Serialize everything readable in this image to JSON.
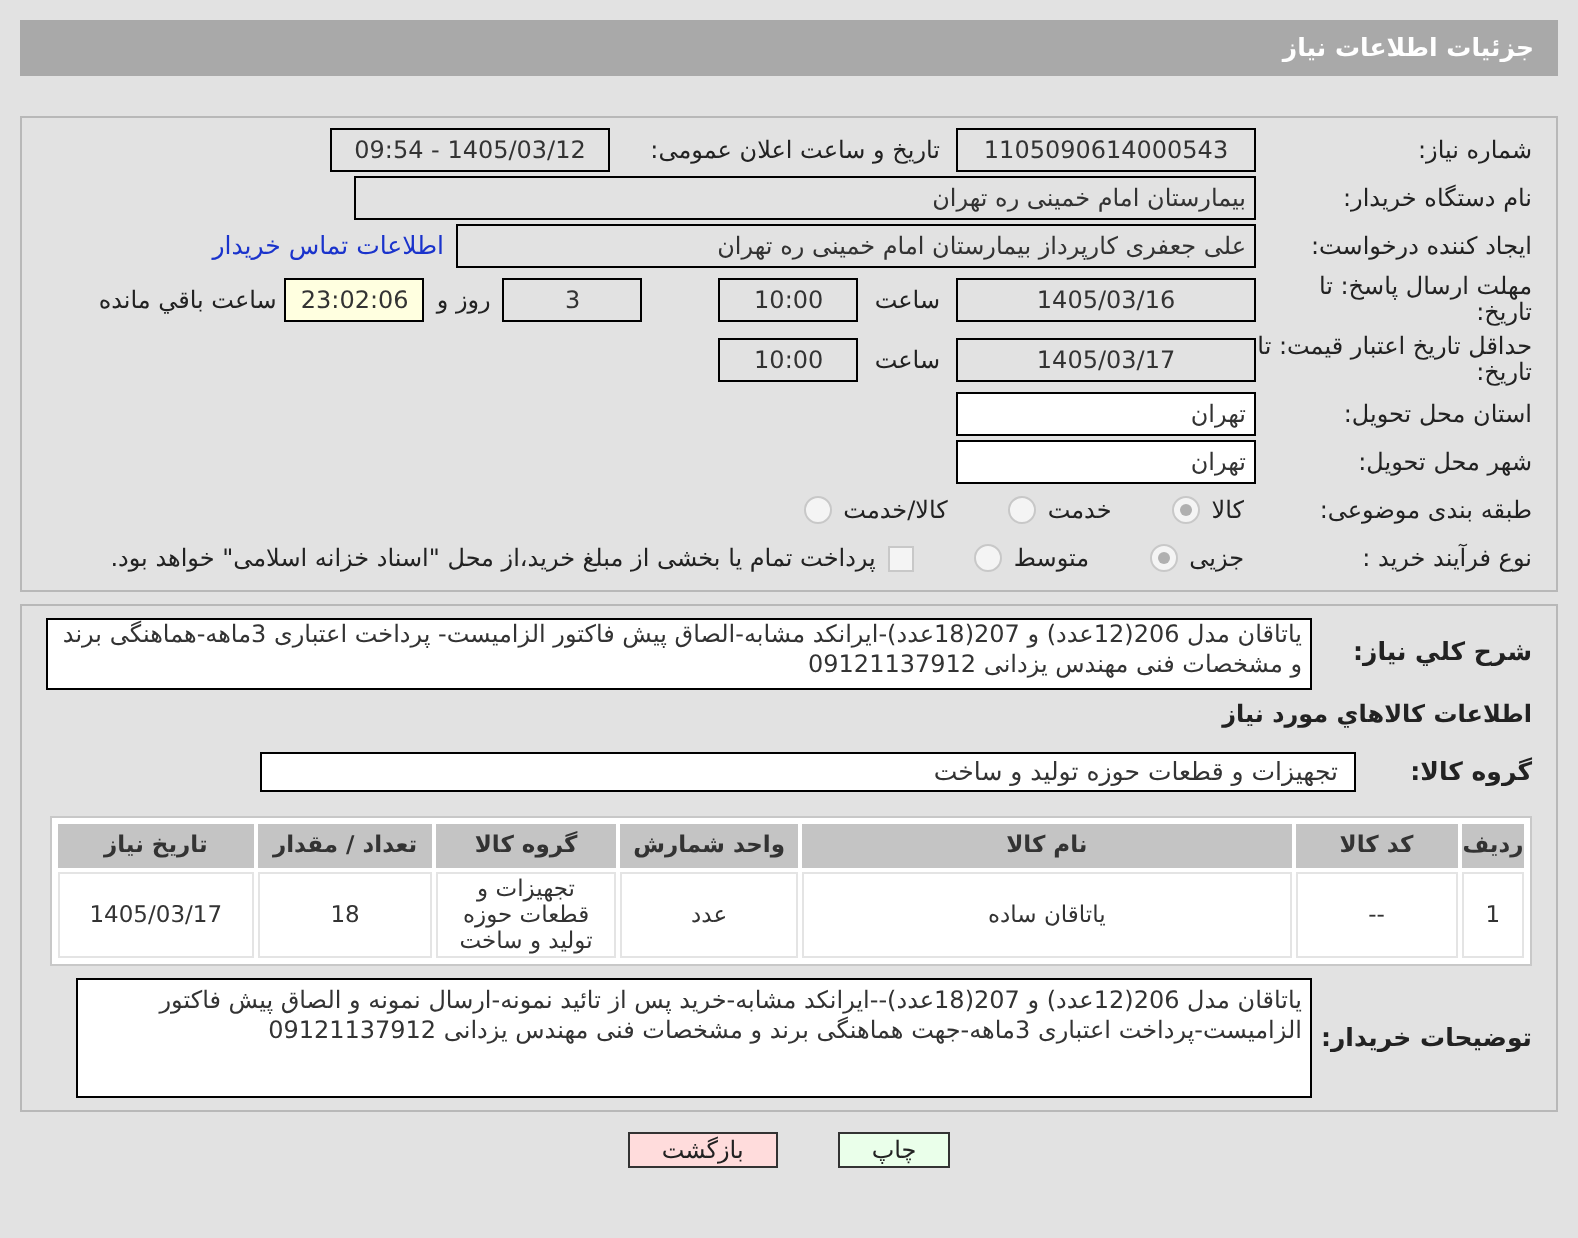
{
  "title": "جزئیات اطلاعات نیاز",
  "form": {
    "need_number": {
      "label": "شماره نیاز:",
      "value": "1105090614000543"
    },
    "announce": {
      "label": "تاریخ و ساعت اعلان عمومی:",
      "value": "1405/03/12 - 09:54"
    },
    "buyer": {
      "label": "نام دستگاه خریدار:",
      "value": "بیمارستان امام خمینی ره  تهران"
    },
    "creator": {
      "label": "ایجاد کننده درخواست:",
      "value": "علی جعفری کارپرداز بیمارستان امام خمینی ره  تهران",
      "link": "اطلاعات تماس خریدار"
    },
    "deadline": {
      "label": "مهلت ارسال پاسخ: تا تاریخ:",
      "date": "1405/03/16",
      "time_label": "ساعت",
      "time": "10:00",
      "days": "3",
      "days_label": "روز و",
      "remaining": "23:02:06",
      "remaining_label": "ساعت باقي مانده"
    },
    "validity": {
      "label": "حداقل تاریخ اعتبار قیمت: تا تاریخ:",
      "date": "1405/03/17",
      "time_label": "ساعت",
      "time": "10:00"
    },
    "province": {
      "label": "استان محل تحویل:",
      "value": "تهران"
    },
    "city": {
      "label": "شهر محل تحویل:",
      "value": "تهران"
    },
    "category": {
      "label": "طبقه بندی موضوعی:",
      "options": [
        {
          "label": "کالا",
          "selected": true
        },
        {
          "label": "خدمت",
          "selected": false
        },
        {
          "label": "کالا/خدمت",
          "selected": false
        }
      ]
    },
    "purchase_type": {
      "label": "نوع فرآیند خرید :",
      "options": [
        {
          "label": "جزیی",
          "selected": true
        },
        {
          "label": "متوسط",
          "selected": false
        }
      ],
      "payment": {
        "label": "پرداخت تمام یا بخشی از مبلغ خرید،از محل \"اسناد خزانه اسلامی\" خواهد بود.",
        "checked": false
      }
    }
  },
  "description": {
    "label": "شرح کلي نیاز:",
    "value": "یاتاقان مدل 206(12عدد) و 207(18عدد)-ایرانکد مشابه-الصاق پیش فاکتور الزامیست- پرداخت اعتباری 3ماهه-هماهنگی برند و مشخصات فنی مهندس یزدانی 09121137912"
  },
  "goods_title": "اطلاعات کالاهاي مورد نیاز",
  "goods_group": {
    "label": "گروه کالا:",
    "value": "تجهیزات و قطعات حوزه تولید و ساخت"
  },
  "table": {
    "columns": [
      "ردیف",
      "کد کالا",
      "نام کالا",
      "واحد شمارش",
      "گروه کالا",
      "تعداد / مقدار",
      "تاریخ نیاز"
    ],
    "rows": [
      [
        "1",
        "--",
        "یاتاقان ساده",
        "عدد",
        "تجهیزات و قطعات حوزه تولید و ساخت",
        "18",
        "1405/03/17"
      ]
    ]
  },
  "buyer_notes": {
    "label": "توضیحات خریدار:",
    "value": "یاتاقان مدل 206(12عدد) و 207(18عدد)--ایرانکد مشابه-خرید پس از تائید نمونه-ارسال نمونه و الصاق پیش فاکتور الزامیست-پرداخت اعتباری 3ماهه-جهت هماهنگی برند و مشخصات فنی مهندس یزدانی 09121137912"
  },
  "buttons": [
    {
      "label": "چاپ",
      "kind": "print"
    },
    {
      "label": "بازگشت",
      "kind": "back"
    }
  ]
}
